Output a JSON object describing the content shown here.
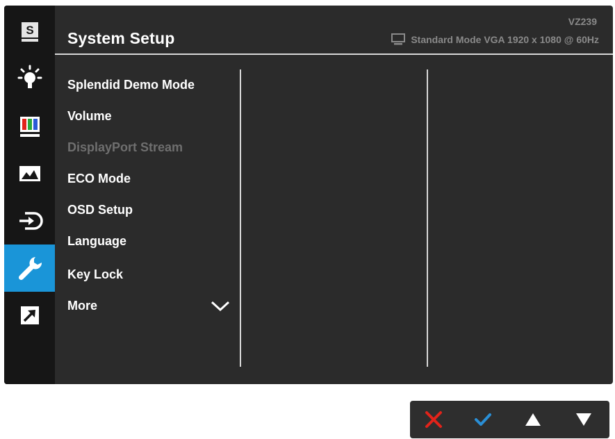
{
  "header": {
    "title": "System Setup",
    "model": "VZ239",
    "status": "Standard Mode VGA  1920 x 1080 @ 60Hz"
  },
  "sidebar": {
    "items": [
      {
        "name": "splendid",
        "icon": "splendid-s-icon",
        "label": "S",
        "active": false
      },
      {
        "name": "brightness",
        "icon": "brightness-icon",
        "active": false
      },
      {
        "name": "color",
        "icon": "color-bars-icon",
        "active": false
      },
      {
        "name": "image",
        "icon": "image-mountain-icon",
        "active": false
      },
      {
        "name": "input-select",
        "icon": "input-select-icon",
        "active": false
      },
      {
        "name": "system-setup",
        "icon": "wrench-icon",
        "active": true
      },
      {
        "name": "shortcut",
        "icon": "shortcut-arrow-icon",
        "active": false
      }
    ]
  },
  "menu": {
    "items": [
      {
        "label": "Splendid Demo Mode",
        "enabled": true
      },
      {
        "label": "Volume",
        "enabled": true
      },
      {
        "label": "DisplayPort Stream",
        "enabled": false
      },
      {
        "label": "ECO Mode",
        "enabled": true
      },
      {
        "label": "OSD Setup",
        "enabled": true
      },
      {
        "label": "Language",
        "enabled": true
      },
      {
        "label": "Key Lock",
        "enabled": true
      },
      {
        "label": "More",
        "enabled": true
      }
    ]
  },
  "keys": [
    {
      "name": "exit",
      "icon": "close-icon",
      "color": "#e2231a"
    },
    {
      "name": "confirm",
      "icon": "check-icon",
      "color": "#2a8fd6"
    },
    {
      "name": "up",
      "icon": "triangle-up-icon",
      "color": "#ffffff"
    },
    {
      "name": "down",
      "icon": "triangle-down-icon",
      "color": "#ffffff"
    }
  ],
  "colors": {
    "accent": "#1a95d8",
    "panel": "#2b2b2b",
    "sidebar": "#161616",
    "disabled_text": "#6f6f6f"
  }
}
